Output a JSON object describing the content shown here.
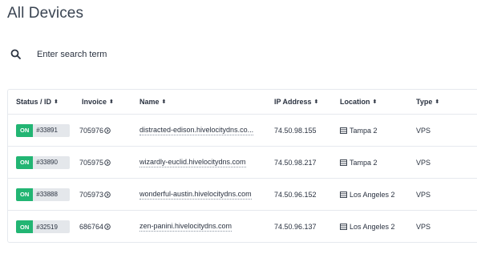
{
  "page": {
    "title": "All Devices"
  },
  "search": {
    "placeholder": "Enter search term",
    "value": ""
  },
  "table": {
    "headers": {
      "status": "Status / ID",
      "invoice": "Invoice",
      "name": "Name",
      "ip": "IP Address",
      "location": "Location",
      "type": "Type"
    },
    "rows": [
      {
        "status": "ON",
        "id": "#33891",
        "invoice": "705976",
        "name": "distracted-edison.hivelocitydns.co...",
        "ip": "74.50.98.155",
        "location": "Tampa 2",
        "type": "VPS"
      },
      {
        "status": "ON",
        "id": "#33890",
        "invoice": "705975",
        "name": "wizardly-euclid.hivelocitydns.com",
        "ip": "74.50.98.217",
        "location": "Tampa 2",
        "type": "VPS"
      },
      {
        "status": "ON",
        "id": "#33888",
        "invoice": "705973",
        "name": "wonderful-austin.hivelocitydns.com",
        "ip": "74.50.96.152",
        "location": "Los Angeles 2",
        "type": "VPS"
      },
      {
        "status": "ON",
        "id": "#32519",
        "invoice": "686764",
        "name": "zen-panini.hivelocitydns.com",
        "ip": "74.50.96.137",
        "location": "Los Angeles 2",
        "type": "VPS"
      }
    ]
  },
  "colors": {
    "status_on": "#22b573",
    "id_badge": "#e4e7eb",
    "text": "#2a3240",
    "border": "#e6e9ee"
  },
  "icons": {
    "search": "search-icon",
    "sort": "sort-icon",
    "invoice_info": "info-circle-icon",
    "location": "server-icon"
  }
}
